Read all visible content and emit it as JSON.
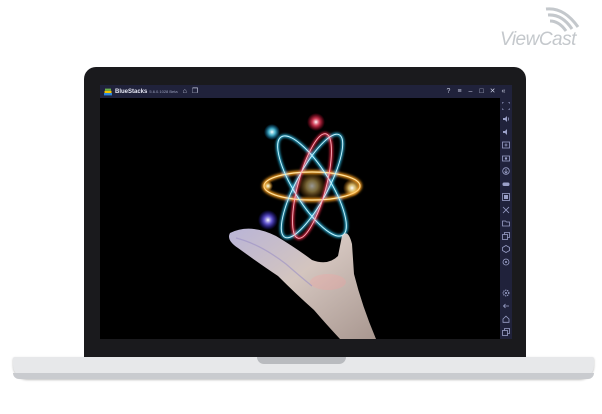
{
  "brand": {
    "logo_text": "ViewCast"
  },
  "window": {
    "app_name": "BlueStacks",
    "version": "5.6.0.1028 Beta"
  },
  "titlebar_icons": [
    "home-icon",
    "multi-instance-icon"
  ],
  "window_controls": [
    "help-icon",
    "menu-icon",
    "minimize-icon",
    "maximize-icon",
    "close-icon",
    "collapse-sidebar-icon"
  ],
  "sidebar": {
    "top_tools": [
      "fullscreen-icon",
      "volume-up-icon",
      "volume-down-icon",
      "keymap-icon",
      "screenshot-icon",
      "install-apk-icon",
      "game-controls-icon",
      "macro-icon",
      "resize-icon",
      "folder-icon",
      "multi-instance-icon",
      "eco-mode-icon",
      "sync-icon"
    ],
    "bottom_tools": [
      "settings-icon",
      "back-icon",
      "home-icon",
      "recent-apps-icon"
    ]
  },
  "colors": {
    "titlebar_bg": "#20223b",
    "bezel": "#1a1a1d",
    "atom_orbit_cyan": "#2fd0ff",
    "atom_orbit_orange": "#ffa21f",
    "atom_orbit_red": "#ff2a4a",
    "atom_core_blue": "#6a5bff"
  }
}
